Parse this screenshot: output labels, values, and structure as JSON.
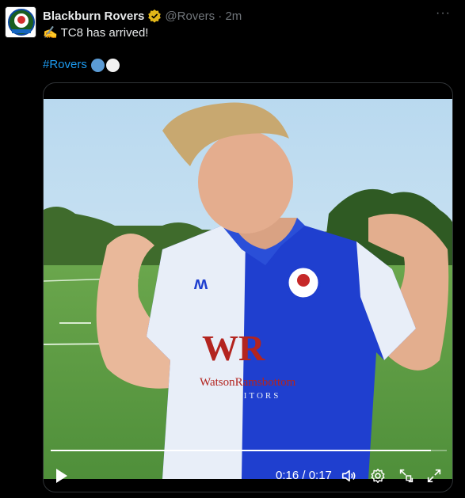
{
  "tweet": {
    "author_name": "Blackburn Rovers",
    "handle_time": "@Rovers · 2m",
    "text": "✍️ TC8 has arrived!",
    "hashtag": "#Rovers",
    "more_label": "···"
  },
  "video": {
    "time_label": "0:16 / 0:17",
    "progress": 0.96,
    "sponsor_logo_text": "WR",
    "sponsor_name": "WatsonRamsbottom",
    "sponsor_sub": "SOLICITORS"
  },
  "colors": {
    "link": "#1d9bf0",
    "verified": "#e2b719",
    "kit_blue": "#1f3fcf",
    "kit_white": "#ffffff"
  },
  "icons": [
    "verified-badge-icon",
    "more-icon",
    "play-icon",
    "volume-icon",
    "settings-icon",
    "pip-icon",
    "fullscreen-icon"
  ]
}
